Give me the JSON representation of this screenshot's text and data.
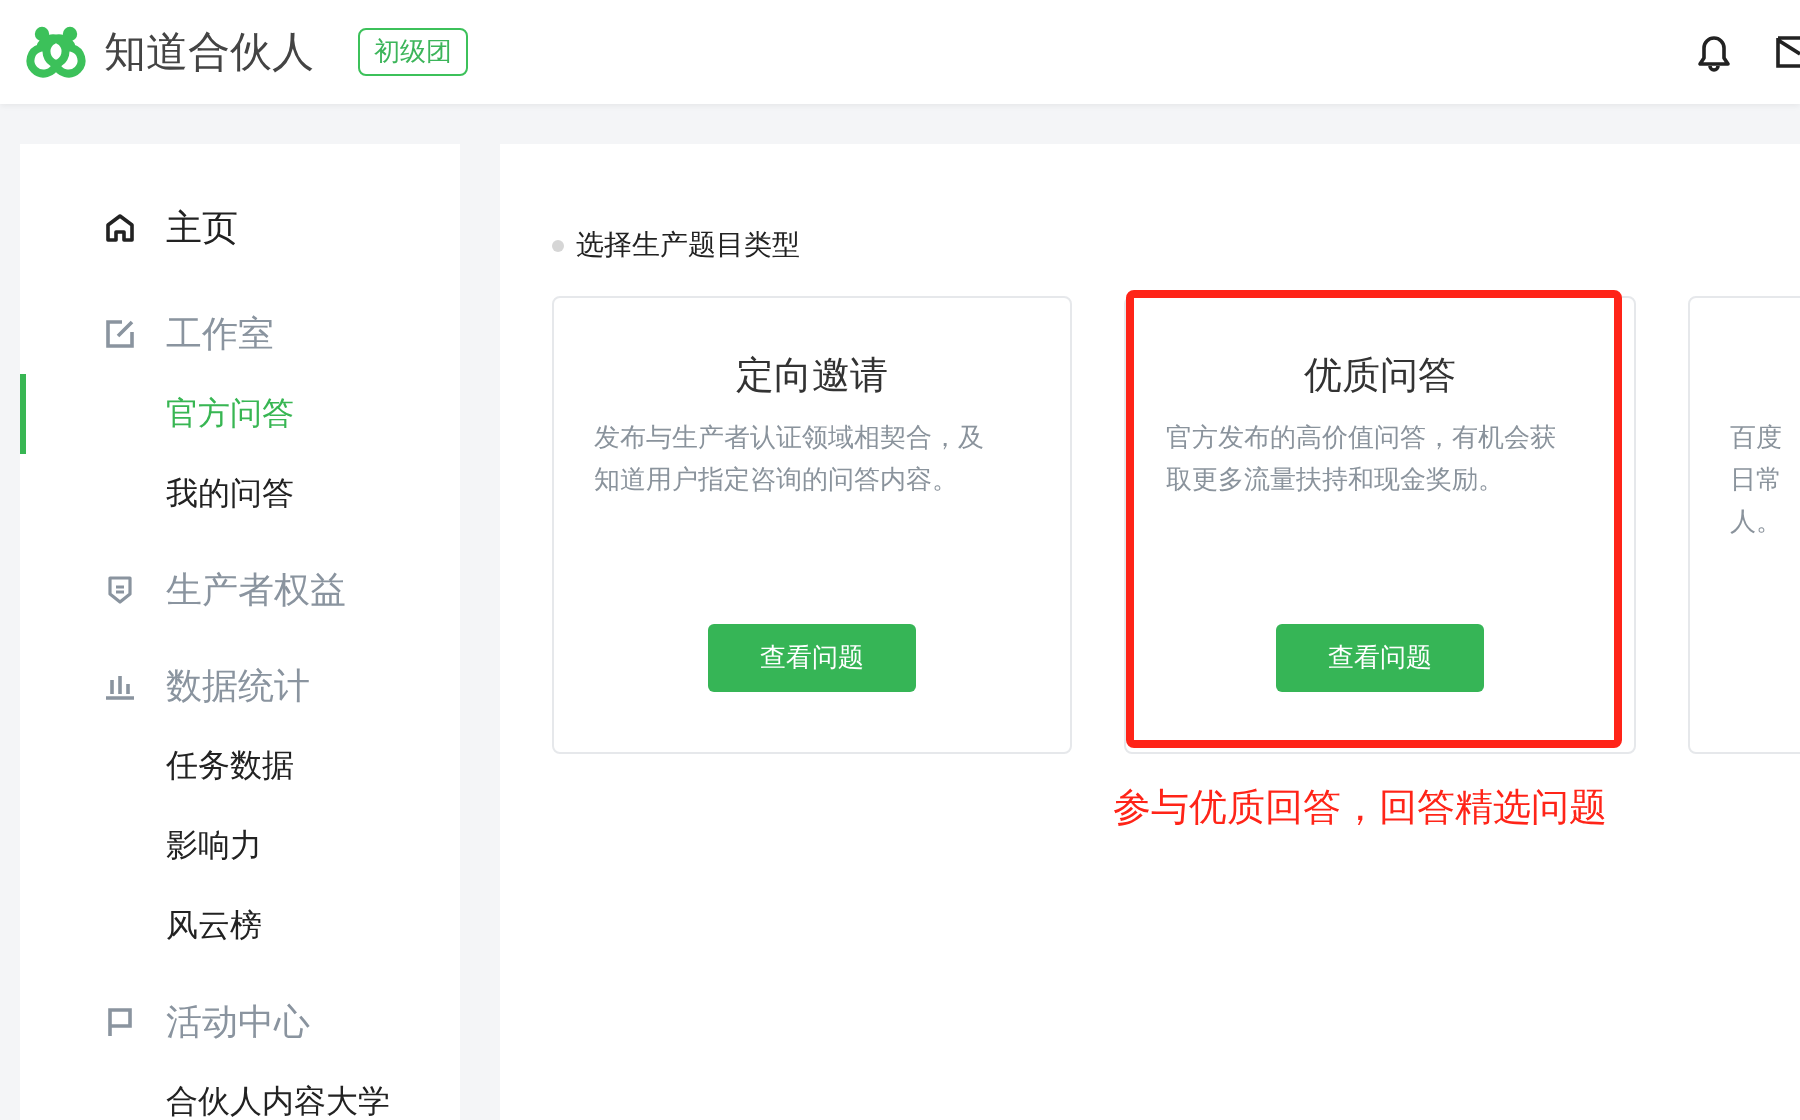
{
  "header": {
    "brand": "知道合伙人",
    "badge": "初级团"
  },
  "sidebar": {
    "items": [
      {
        "label": "主页",
        "kind": "link",
        "selected": false
      },
      {
        "label": "工作室",
        "kind": "section",
        "selected": false,
        "children": [
          {
            "label": "官方问答",
            "selected": true
          },
          {
            "label": "我的问答",
            "selected": false
          }
        ]
      },
      {
        "label": "生产者权益",
        "kind": "section",
        "selected": false
      },
      {
        "label": "数据统计",
        "kind": "section",
        "selected": false,
        "children": [
          {
            "label": "任务数据",
            "selected": false
          },
          {
            "label": "影响力",
            "selected": false
          },
          {
            "label": "风云榜",
            "selected": false
          }
        ]
      },
      {
        "label": "活动中心",
        "kind": "section",
        "selected": false,
        "children": [
          {
            "label": "合伙人内容大学",
            "selected": false
          }
        ]
      }
    ]
  },
  "main": {
    "heading": "选择生产题目类型",
    "cards": [
      {
        "title": "定向邀请",
        "description": [
          "发布与生产者认证领域相契合，及",
          "知道用户指定咨询的问答内容。"
        ],
        "button": "查看问题",
        "highlighted": false
      },
      {
        "title": "优质问答",
        "description": [
          "官方发布的高价值问答，有机会获",
          "取更多流量扶持和现金奖励。"
        ],
        "button": "查看问题",
        "highlighted": true
      },
      {
        "description": [
          "百度",
          "日常",
          "人。"
        ],
        "highlighted": false
      }
    ],
    "annotation": "参与优质回答，回答精选问题"
  }
}
